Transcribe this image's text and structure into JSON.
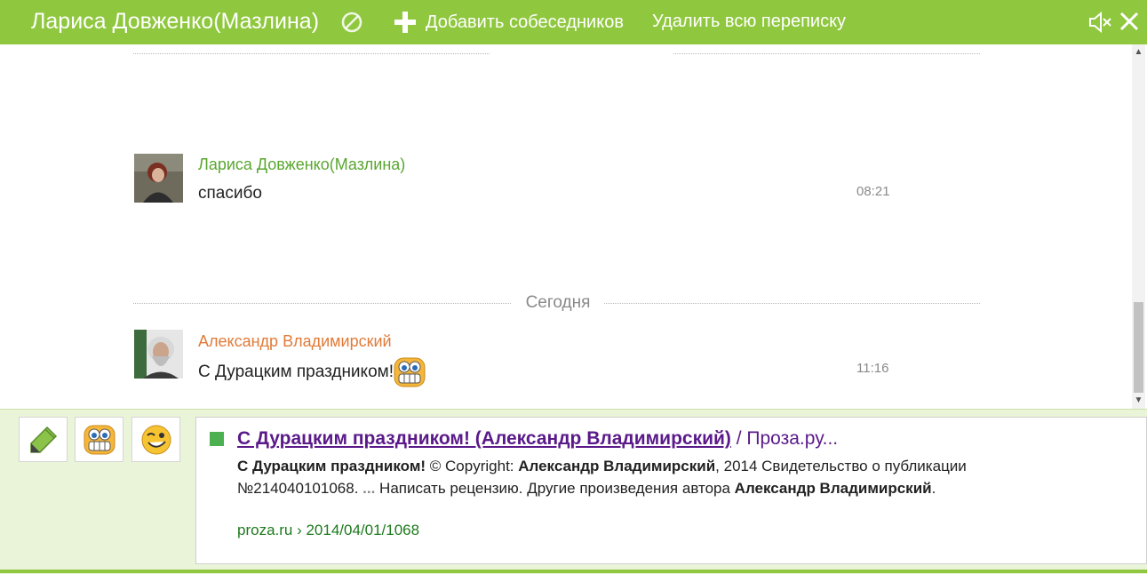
{
  "header": {
    "title": "Лариса Довженко(Мазлина)",
    "add_label": "Добавить собеседников",
    "delete_label": "Удалить всю переписку",
    "icons": [
      "block-icon",
      "plus-icon",
      "mute-icon",
      "close-icon"
    ]
  },
  "messages": [
    {
      "sender": "Лариса Довженко(Мазлина)",
      "text": "спасибо",
      "time": "08:21",
      "color": "#5aa630"
    },
    {
      "sender": "Александр Владимирский",
      "text": "С Дурацким праздником!",
      "time": "11:16",
      "color": "#e07b39"
    }
  ],
  "date_separator": "Сегодня",
  "toolbar": {
    "icons": [
      "pencil-icon",
      "grin-emoticon-icon",
      "wink-emoticon-icon"
    ]
  },
  "search_result": {
    "title_part1": "С Дурацким праздником! (Александр Владимирский)",
    "title_part2": " / Проза.ру...",
    "snippet": [
      {
        "t": "С Дурацким праздником!",
        "b": true
      },
      {
        "t": " © Copyright: ",
        "b": false
      },
      {
        "t": "Александр Владимирский",
        "b": true
      },
      {
        "t": ", 2014 Свидетельство о публикации №214040101068. ",
        "b": false
      },
      {
        "t": "...",
        "b": true
      },
      {
        "t": " Написать рецензию. Другие произведения автора ",
        "b": false
      },
      {
        "t": "Александр Владимирский",
        "b": true
      },
      {
        "t": ".",
        "b": false
      }
    ],
    "url": "proza.ru › 2014/04/01/1068"
  },
  "colors": {
    "accent": "#8fc73e",
    "panel": "#e9f4d9"
  }
}
